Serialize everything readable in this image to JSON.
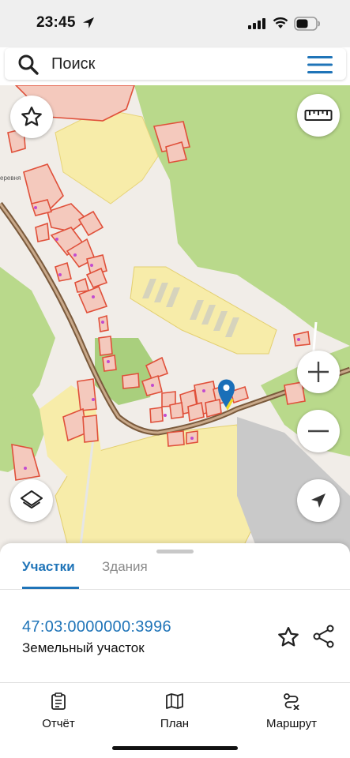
{
  "status_bar": {
    "time": "23:45",
    "icons": [
      "location-arrow-icon",
      "signal-icon",
      "wifi-icon",
      "battery-icon"
    ]
  },
  "search": {
    "placeholder": "Поиск",
    "icons": [
      "search-icon",
      "menu-icon"
    ]
  },
  "map": {
    "place_label": "еревня",
    "controls": [
      "favorite-star-icon",
      "ruler-icon",
      "zoom-in-icon",
      "zoom-out-icon",
      "layers-icon",
      "my-location-icon"
    ],
    "colors": {
      "forest": "#b9d98b",
      "background": "#f1ede8",
      "plot_fill": "#f4c9bd",
      "plot_border": "#e0503a",
      "yellow_zone": "#f7eca9",
      "road": "#8a6a4a",
      "marker": "#1a6fb8"
    }
  },
  "sheet": {
    "tabs": [
      {
        "label": "Участки",
        "active": true
      },
      {
        "label": "Здания",
        "active": false
      }
    ],
    "parcel": {
      "cadastral_number": "47:03:0000000:3996",
      "type": "Земельный участок"
    },
    "actions": [
      "favorite-star-icon",
      "share-icon"
    ],
    "accent_color": "#1f74b8"
  },
  "bottom_nav": {
    "items": [
      {
        "label": "Отчёт",
        "icon": "report-clipboard-icon"
      },
      {
        "label": "План",
        "icon": "map-plan-icon"
      },
      {
        "label": "Маршрут",
        "icon": "route-icon"
      }
    ]
  }
}
